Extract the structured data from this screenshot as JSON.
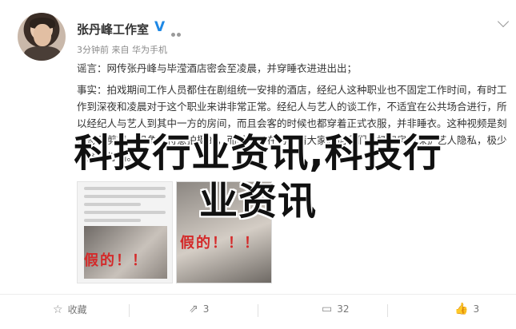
{
  "post": {
    "author": "张丹峰工作室",
    "verified_mark": "V",
    "meta": "3分钟前 来自 华为手机",
    "paragraph1": "谣言：网传张丹峰与毕滢酒店密会至凌晨，并穿睡衣进进出出；",
    "paragraph2": "事实：拍戏期间工作人员都住在剧组统一安排的酒店，经纪人这种职业也不固定工作时间，有时工作到深夜和凌晨对于这个职业来讲非常正常。经纪人与艺人的谈工作，不适宜在公共场合进行，所以经纪人与艺人到其中一方的房间，而且会客的时候也都穿着正式衣服，并非睡衣。这种视频是刻意恶意剪辑，用角度特意拍摄的，而其他人在场，请大家相信我们，打扫房间保护艺人隐私，极少服务员打扫。",
    "stamp_left": "假的！！",
    "stamp_right": "假的！！！"
  },
  "overlay": {
    "line1": "科技行业资讯,科技行",
    "line2": "业资讯"
  },
  "actions": {
    "favorite_label": "收藏",
    "repost_count": "3",
    "comment_count": "32",
    "like_count": "3"
  },
  "icons": {
    "favorite": "star-outline-icon",
    "repost": "repost-icon",
    "comment": "comment-icon",
    "like": "thumbs-up-icon",
    "menu": "chevron-down-icon"
  }
}
